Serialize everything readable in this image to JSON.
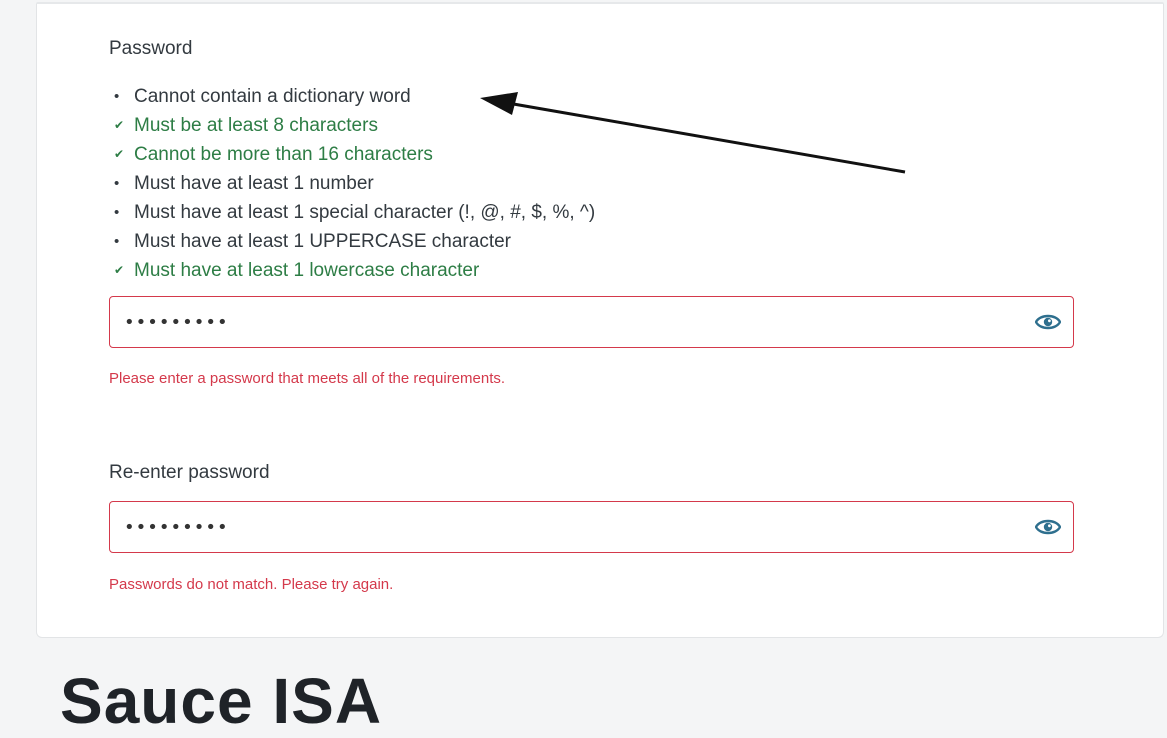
{
  "password_section": {
    "label": "Password",
    "requirements": [
      {
        "text": "Cannot contain a dictionary word",
        "met": false
      },
      {
        "text": "Must be at least 8 characters",
        "met": true
      },
      {
        "text": "Cannot be more than 16 characters",
        "met": true
      },
      {
        "text": "Must have at least 1 number",
        "met": false
      },
      {
        "text": "Must have at least 1 special character (!, @, #, $, %, ^)",
        "met": false
      },
      {
        "text": "Must have at least 1 UPPERCASE character",
        "met": false
      },
      {
        "text": "Must have at least 1 lowercase character",
        "met": true
      }
    ],
    "input_value": "•••••••••",
    "show_icon": "eye-icon",
    "error": "Please enter a password that meets all of the requirements."
  },
  "reenter_section": {
    "label": "Re-enter password",
    "input_value": "•••••••••",
    "show_icon": "eye-icon",
    "error": "Passwords do not match. Please try again."
  },
  "next_section": {
    "heading_partial": "Sauce ISA"
  },
  "colors": {
    "error": "#d4394b",
    "met": "#2d7d45",
    "unmet": "#333a40",
    "eye_icon": "#2e6f8e"
  },
  "annotation": {
    "type": "arrow",
    "points_to": "Cannot contain a dictionary word"
  }
}
